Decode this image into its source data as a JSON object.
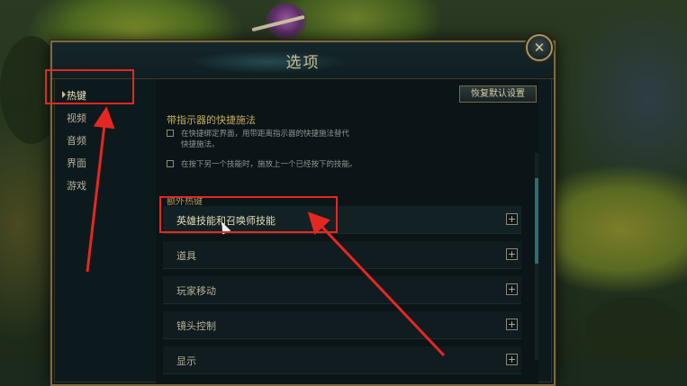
{
  "dialog": {
    "title": "选项",
    "close_glyph": "✕"
  },
  "sidebar": {
    "items": [
      {
        "label": "热键",
        "active": true
      },
      {
        "label": "视频",
        "active": false
      },
      {
        "label": "音频",
        "active": false
      },
      {
        "label": "界面",
        "active": false
      },
      {
        "label": "游戏",
        "active": false
      }
    ]
  },
  "content": {
    "restore_defaults_label": "恢复默认设置",
    "section_title": "带指示器的快捷施法",
    "options": [
      {
        "text_line1": "在快捷绑定界面，用带距离指示器的快捷施法替代",
        "text_line2": "快捷施法。",
        "checked": false
      },
      {
        "text_line1": "在按下另一个技能时，施放上一个已经按下的技能。",
        "text_line2": "",
        "checked": false
      }
    ],
    "extra_title": "额外热键",
    "hotkey_groups": [
      {
        "label": "英雄技能和召唤师技能",
        "expand_glyph": "+"
      },
      {
        "label": "道具",
        "expand_glyph": "+"
      },
      {
        "label": "玩家移动",
        "expand_glyph": "+"
      },
      {
        "label": "镜头控制",
        "expand_glyph": "+"
      },
      {
        "label": "显示",
        "expand_glyph": "+"
      }
    ]
  },
  "annotation_color": "#e52722",
  "icons": {
    "close": "close-icon",
    "expand": "plus-icon",
    "cursor": "mouse-cursor-icon"
  }
}
